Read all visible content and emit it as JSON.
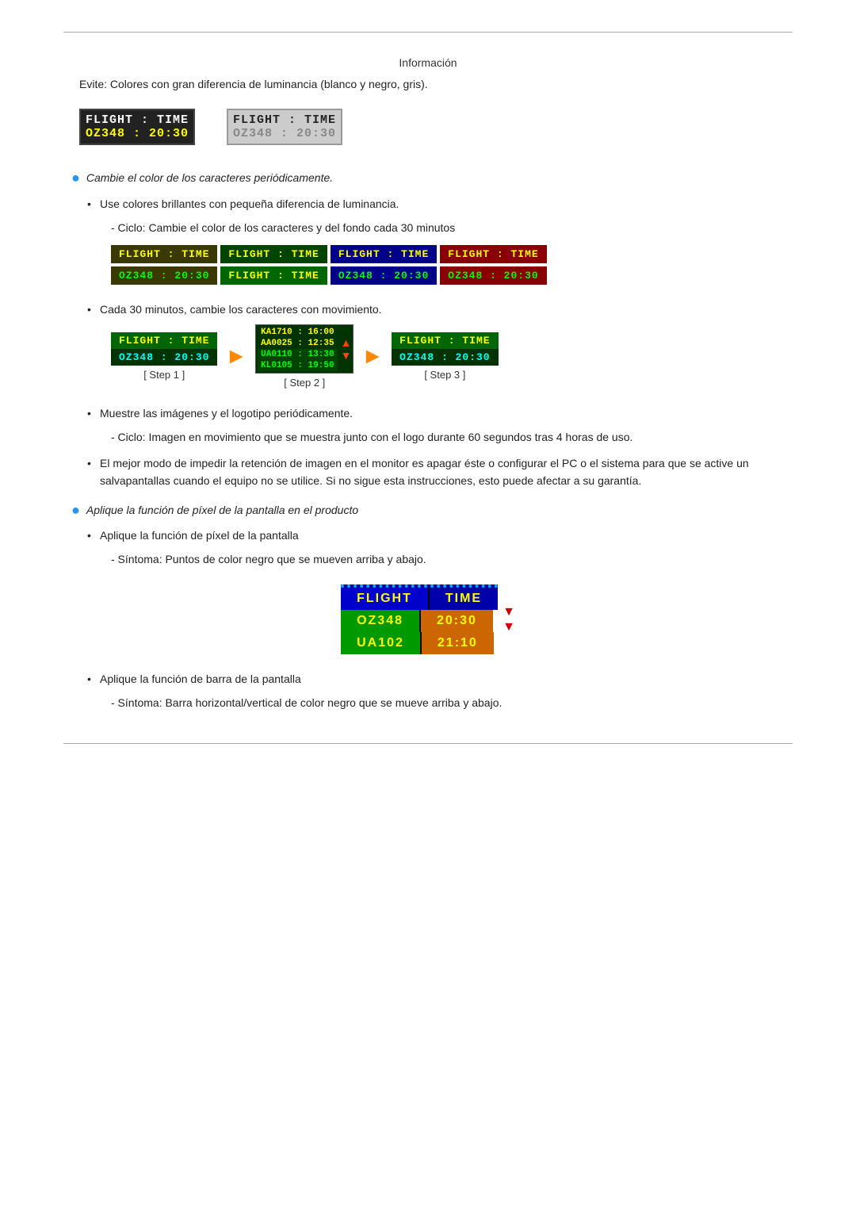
{
  "page": {
    "title": "Información",
    "top_text": "Evite: Colores con gran diferencia de luminancia (blanco y negro, gris).",
    "box1": {
      "header": "FLIGHT  :  TIME",
      "data": "OZ348   :  20:30"
    },
    "box2": {
      "header": "FLIGHT  :  TIME",
      "data": "OZ348   :  20:30"
    },
    "bullet1": {
      "text": "Cambie el color de los caracteres periódicamente."
    },
    "plain1": "Use colores brillantes con pequeña diferencia de luminancia.",
    "sub1": "- Ciclo: Cambie el color de los caracteres y del fondo cada 30 minutos",
    "plain2": "Cada 30 minutos, cambie los caracteres con movimiento.",
    "step1_label": "[ Step 1 ]",
    "step2_label": "[ Step 2 ]",
    "step3_label": "[ Step 3 ]",
    "step1_header": "FLIGHT  : TIME",
    "step1_data": "OZ348  : 20:30",
    "step2_line1": "KA1710 : 16:00",
    "step2_line2": "AA0025 : 12:35",
    "step2_line3": "UA0110 : 13:30",
    "step2_line4": "KL0105 : 19:50",
    "step3_header": "FLIGHT  : TIME",
    "step3_data": "OZ348  : 20:30",
    "plain3": "Muestre las imágenes y el logotipo periódicamente.",
    "sub2": "- Ciclo: Imagen en movimiento que se muestra junto con el logo durante 60 segundos tras 4 horas de uso.",
    "plain4": "El mejor modo de impedir la retención de imagen en el monitor es apagar éste o configurar el PC o el sistema para que se active un salvapantallas cuando el equipo no se utilice. Si no sigue esta instrucciones, esto puede afectar a su garantía.",
    "bullet2": {
      "text": "Aplique la función de píxel de la pantalla en el producto"
    },
    "plain5": "Aplique la función de píxel de la pantalla",
    "sub3": "- Síntoma: Puntos de color negro que se mueven arriba y abajo.",
    "pixel_header1": "FLIGHT",
    "pixel_header2": "TIME",
    "pixel_row1_col1": "OZ348",
    "pixel_row1_col2": "20:30",
    "pixel_row2_col1": "UA102",
    "pixel_row2_col2": "21:10",
    "plain6": "Aplique la función de barra de la pantalla",
    "sub4": "- Síntoma: Barra horizontal/vertical de color negro que se mueve arriba y abajo.",
    "cycle_headers": [
      "FLIGHT  : TIME",
      "FLIGHT  : TIME",
      "FLIGHT  : TIME",
      "FLIGHT  : TIME"
    ],
    "cycle_data": [
      "OZ348  : 20:30",
      "FLIGHT  : TIME",
      "OZ348  : 20:30",
      "OZ348  : 20:30"
    ]
  }
}
